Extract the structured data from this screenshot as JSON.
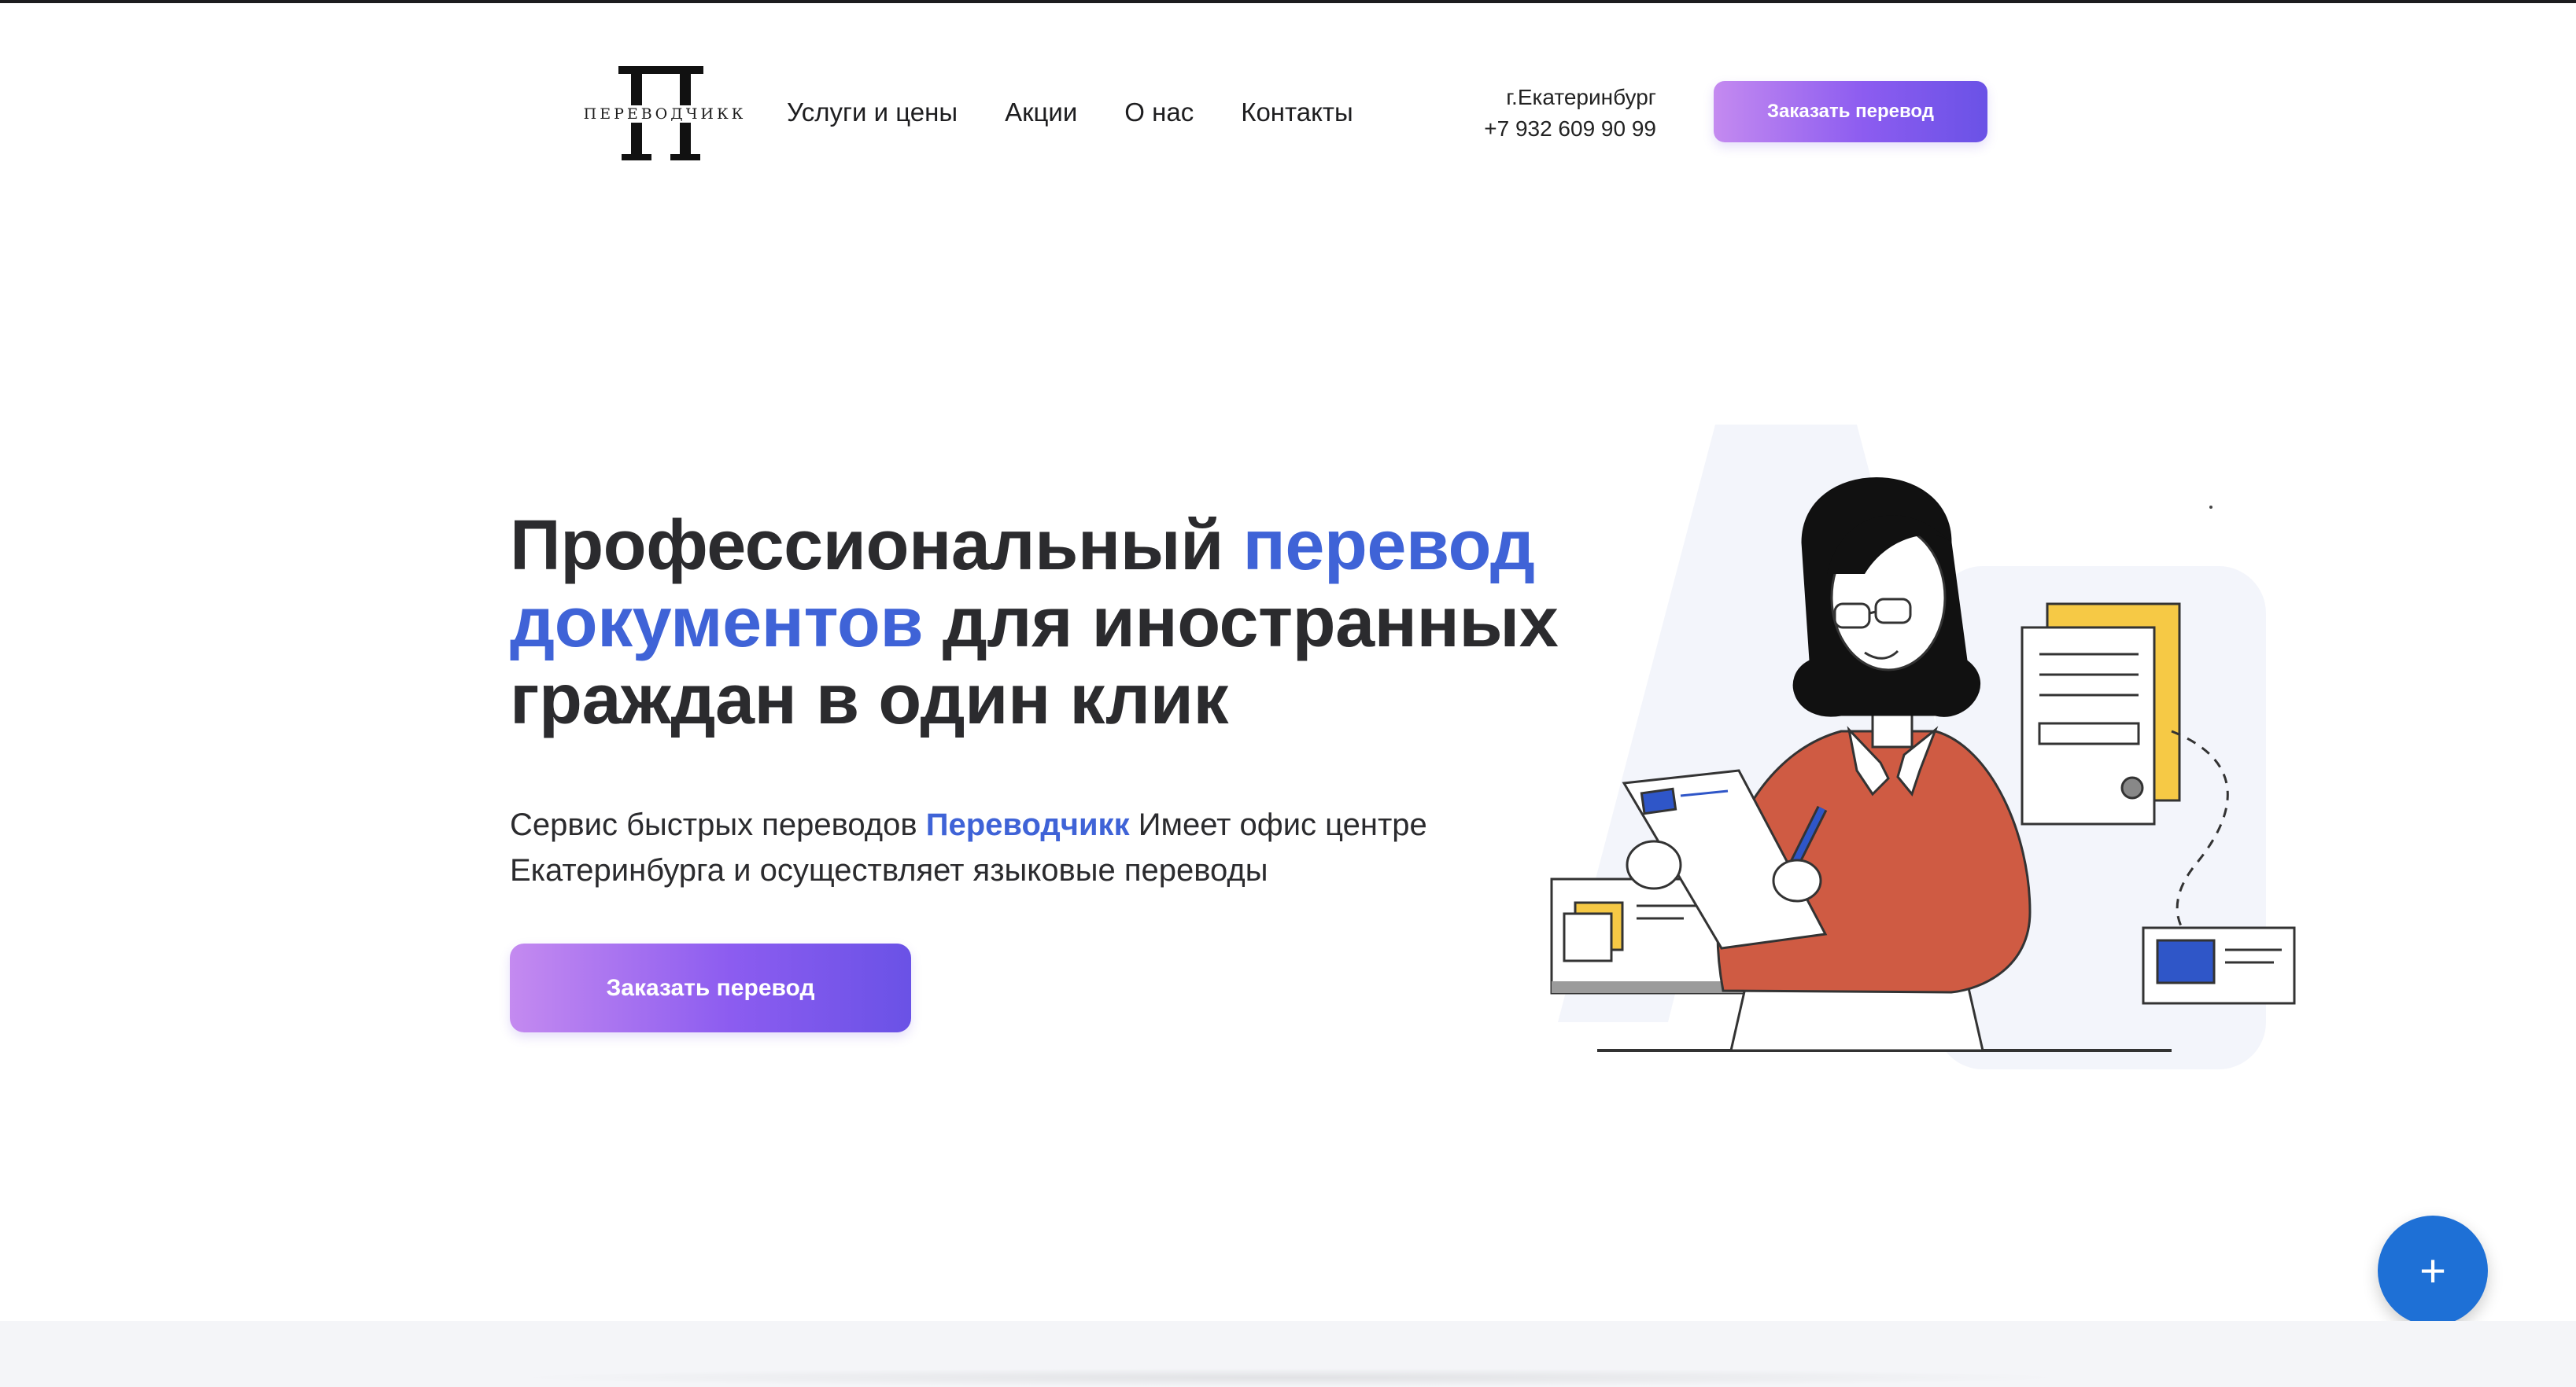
{
  "header": {
    "logo": {
      "text": "ПЕРЕВОДЧИКК",
      "glyph": "П"
    },
    "nav": [
      "Услуги и цены",
      "Акции",
      "О нас",
      "Контакты"
    ],
    "contact": {
      "city": "г.Екатеринбург",
      "phone": "+7 932 609 90 99"
    },
    "cta_label": "Заказать перевод"
  },
  "hero": {
    "title": {
      "part1": "Профессиональный ",
      "highlight": "перевод документов",
      "part2": " для иностранных граждан в один клик"
    },
    "subtitle": {
      "part1": "Сервис быстрых переводов ",
      "brand": "Переводчикк",
      "part2": " Имеет офис центре Екатеринбурга и осуществляет языковые переводы"
    },
    "cta_label": "Заказать перевод"
  },
  "fab": {
    "icon": "plus-icon",
    "glyph": "+"
  },
  "colors": {
    "accent_blue": "#3f63d7",
    "gradient_start": "#c48af0",
    "gradient_end": "#6a52e6",
    "fab_blue": "#1e70d6",
    "sweater": "#cf5b43",
    "doc_yellow": "#f6c945"
  }
}
